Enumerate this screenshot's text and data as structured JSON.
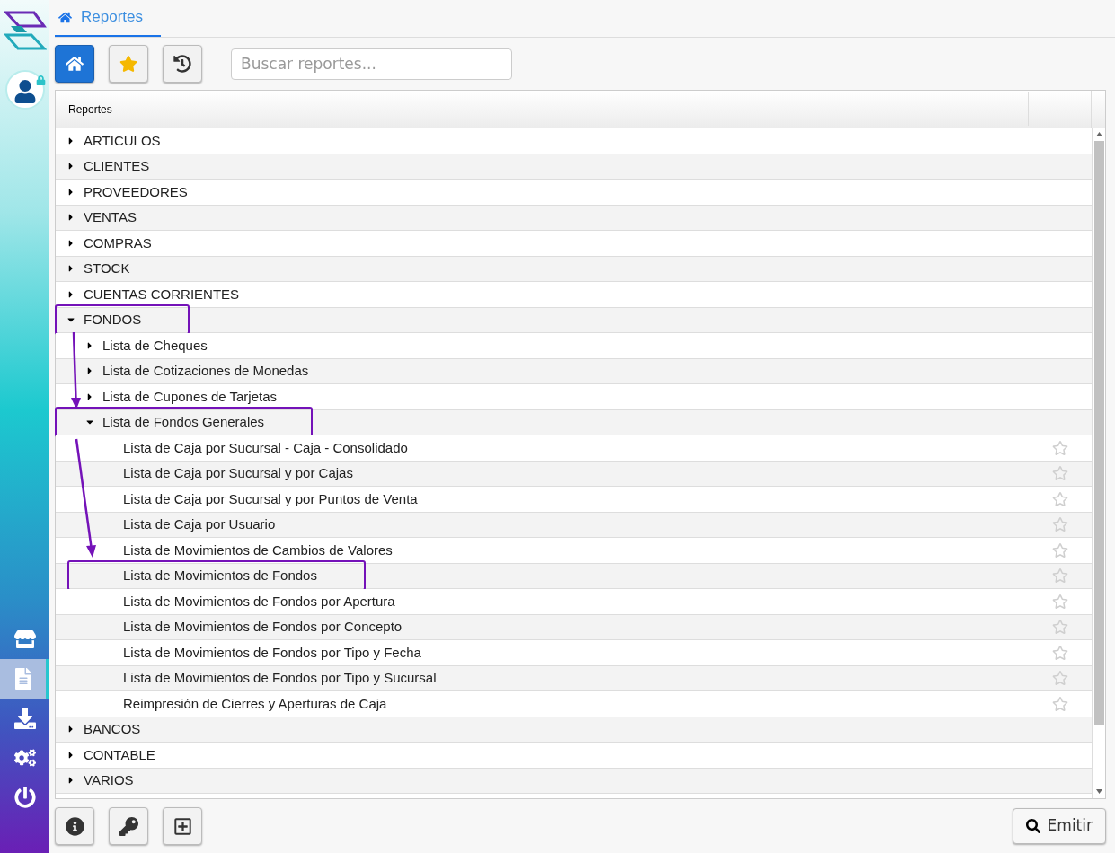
{
  "sidebar": {
    "items": [
      {
        "kind": "store",
        "selected": false
      },
      {
        "kind": "reports",
        "selected": true
      },
      {
        "kind": "download",
        "selected": false
      },
      {
        "kind": "settings",
        "selected": false
      },
      {
        "kind": "power",
        "selected": false
      }
    ]
  },
  "tab": {
    "label": "Reportes",
    "selected": true
  },
  "toolbar": [
    {
      "kind": "home",
      "selected": true
    },
    {
      "kind": "favorites",
      "selected": false
    },
    {
      "kind": "history",
      "selected": false
    }
  ],
  "search": {
    "placeholder": "Buscar reportes..."
  },
  "table": {
    "columns": [
      "Reportes"
    ],
    "rows": [
      {
        "kind": "folder",
        "label": "ARTICULOS",
        "expanded": false,
        "highlighted": false
      },
      {
        "kind": "folder",
        "label": "CLIENTES",
        "expanded": false,
        "highlighted": false
      },
      {
        "kind": "folder",
        "label": "PROVEEDORES",
        "expanded": false,
        "highlighted": false
      },
      {
        "kind": "folder",
        "label": "VENTAS",
        "expanded": false,
        "highlighted": false
      },
      {
        "kind": "folder",
        "label": "COMPRAS",
        "expanded": false,
        "highlighted": false
      },
      {
        "kind": "folder",
        "label": "STOCK",
        "expanded": false,
        "highlighted": false
      },
      {
        "kind": "folder",
        "label": "CUENTAS CORRIENTES",
        "expanded": false,
        "highlighted": false
      },
      {
        "kind": "folder",
        "label": "FONDOS",
        "expanded": true,
        "highlighted": true,
        "children": [
          {
            "kind": "folder",
            "label": "Lista de Cheques",
            "expanded": false,
            "highlighted": false
          },
          {
            "kind": "folder",
            "label": "Lista de Cotizaciones de Monedas",
            "expanded": false,
            "highlighted": false
          },
          {
            "kind": "folder",
            "label": "Lista de Cupones de Tarjetas",
            "expanded": false,
            "highlighted": false
          },
          {
            "kind": "folder",
            "label": "Lista de Fondos Generales",
            "expanded": true,
            "highlighted": true,
            "children": [
              {
                "kind": "report",
                "label": "Lista de Caja por Sucursal - Caja - Consolidado",
                "favorite": false,
                "highlighted": false
              },
              {
                "kind": "report",
                "label": "Lista de Caja por Sucursal y por Cajas",
                "favorite": false,
                "highlighted": false
              },
              {
                "kind": "report",
                "label": "Lista de Caja por Sucursal y por Puntos de Venta",
                "favorite": false,
                "highlighted": false
              },
              {
                "kind": "report",
                "label": "Lista de Caja por Usuario",
                "favorite": false,
                "highlighted": false
              },
              {
                "kind": "report",
                "label": "Lista de Movimientos de Cambios de Valores",
                "favorite": false,
                "highlighted": false
              },
              {
                "kind": "report",
                "label": "Lista de Movimientos de Fondos",
                "favorite": false,
                "highlighted": true
              },
              {
                "kind": "report",
                "label": "Lista de Movimientos de Fondos por Apertura",
                "favorite": false,
                "highlighted": false
              },
              {
                "kind": "report",
                "label": "Lista de Movimientos de Fondos por Concepto",
                "favorite": false,
                "highlighted": false
              },
              {
                "kind": "report",
                "label": "Lista de Movimientos de Fondos por Tipo y Fecha",
                "favorite": false,
                "highlighted": false
              },
              {
                "kind": "report",
                "label": "Lista de Movimientos de Fondos por Tipo y Sucursal",
                "favorite": false,
                "highlighted": false
              },
              {
                "kind": "report",
                "label": "Reimpresión de Cierres y Aperturas de Caja",
                "favorite": false,
                "highlighted": false
              }
            ]
          }
        ]
      },
      {
        "kind": "folder",
        "label": "BANCOS",
        "expanded": false,
        "highlighted": false
      },
      {
        "kind": "folder",
        "label": "CONTABLE",
        "expanded": false,
        "highlighted": false
      },
      {
        "kind": "folder",
        "label": "VARIOS",
        "expanded": false,
        "highlighted": false
      }
    ]
  },
  "footer_buttons": [
    {
      "kind": "info"
    },
    {
      "kind": "key"
    },
    {
      "kind": "add"
    }
  ],
  "emit_button": {
    "label": "Emitir"
  }
}
